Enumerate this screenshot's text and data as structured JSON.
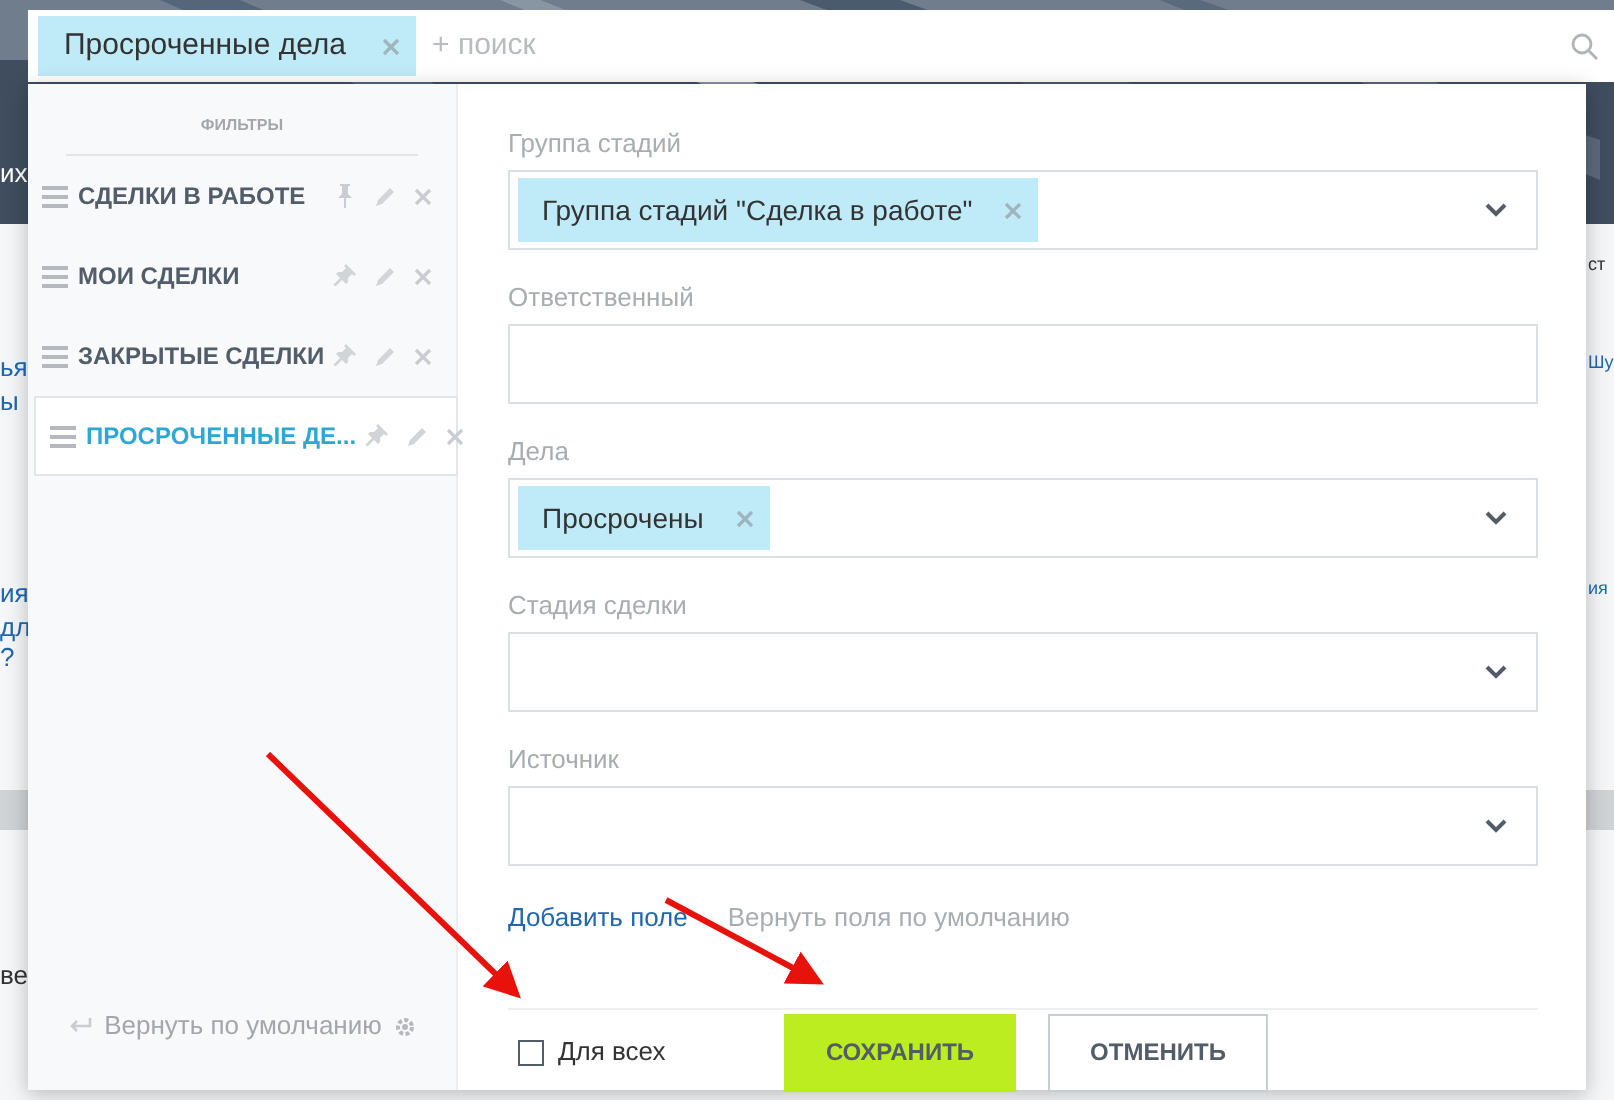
{
  "search_bar": {
    "tag": "Просроченные дела",
    "placeholder": "+ поиск"
  },
  "background_fragments": {
    "left": [
      "их",
      "ья",
      "ы",
      "ия",
      "дл",
      "?",
      "ве"
    ],
    "right": [
      "ст",
      "Шу",
      "ия"
    ]
  },
  "sidebar": {
    "title": "ФИЛЬТРЫ",
    "items": [
      {
        "label": "СДЕЛКИ В РАБОТЕ",
        "selected": false,
        "pinned": true
      },
      {
        "label": "МОИ СДЕЛКИ",
        "selected": false,
        "pinned": false
      },
      {
        "label": "ЗАКРЫТЫЕ СДЕЛКИ",
        "selected": false,
        "pinned": false
      },
      {
        "label": "ПРОСРОЧЕННЫЕ ДЕ...",
        "selected": true,
        "pinned": false
      }
    ],
    "reset": "Вернуть по умолчанию"
  },
  "fields": [
    {
      "label": "Группа стадий",
      "kind": "select",
      "tags": [
        "Группа стадий \"Сделка в работе\""
      ]
    },
    {
      "label": "Ответственный",
      "kind": "text"
    },
    {
      "label": "Дела",
      "kind": "select",
      "tags": [
        "Просрочены"
      ]
    },
    {
      "label": "Стадия сделки",
      "kind": "select"
    },
    {
      "label": "Источник",
      "kind": "select"
    }
  ],
  "links": {
    "add_field": "Добавить поле",
    "restore_fields": "Вернуть поля по умолчанию"
  },
  "footer": {
    "for_all": {
      "label": "Для всех",
      "checked": false
    },
    "save": "СОХРАНИТЬ",
    "cancel": "ОТМЕНИТЬ"
  }
}
